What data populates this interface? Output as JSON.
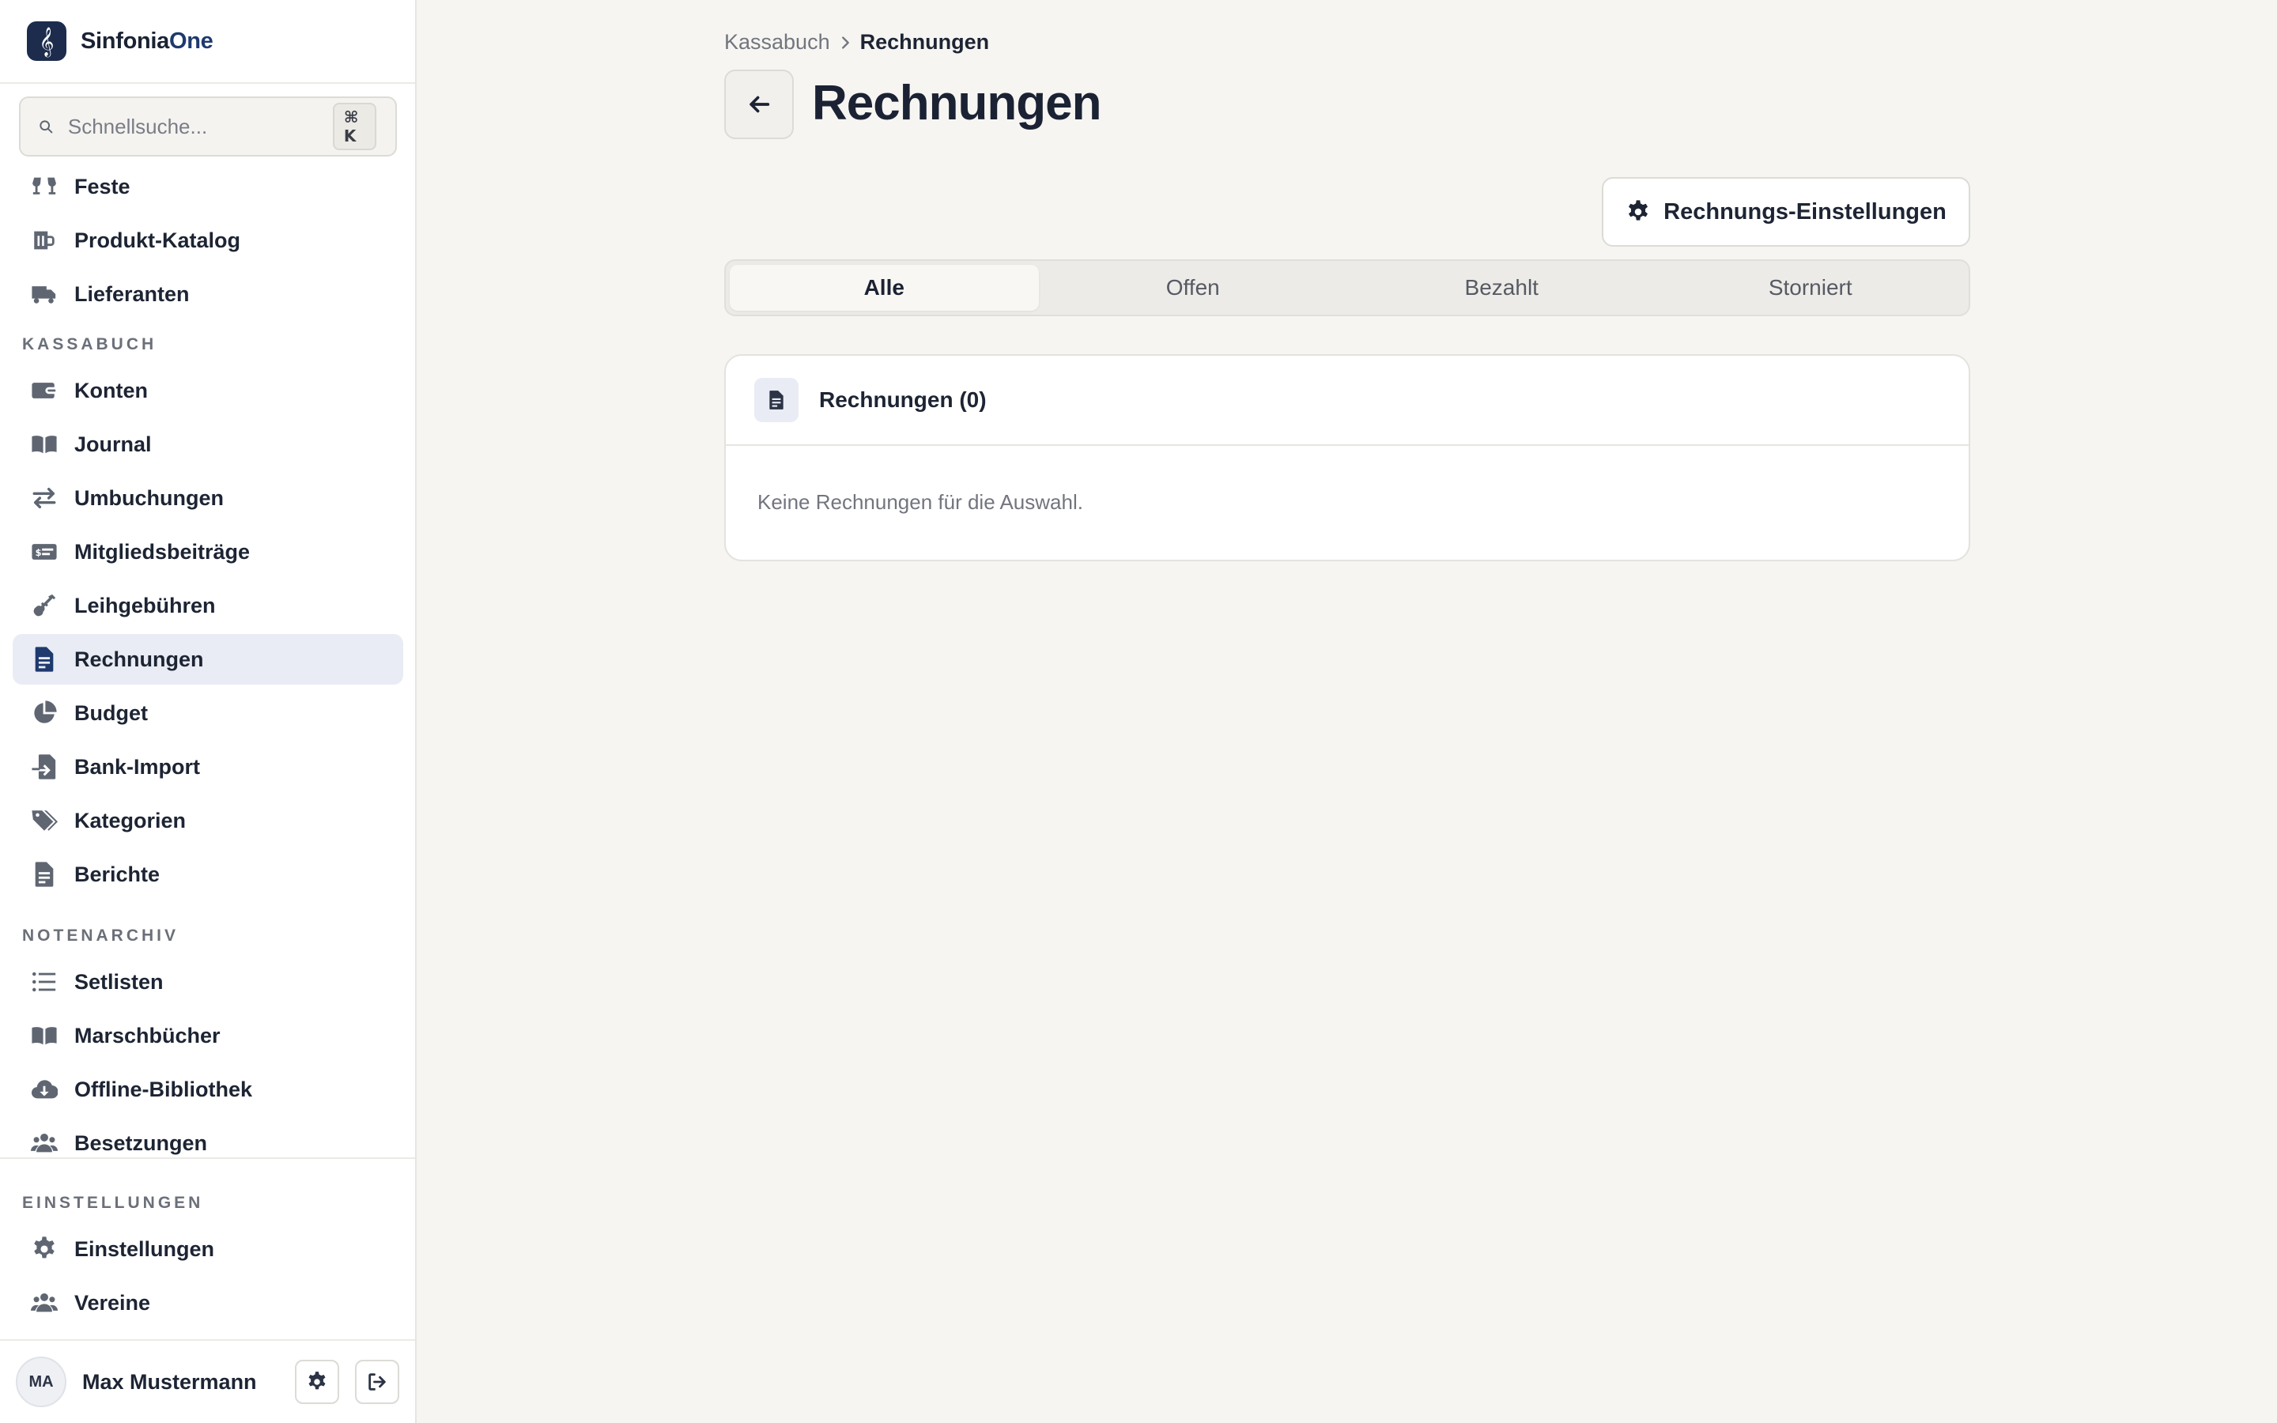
{
  "brand": {
    "prefix": "Sinfonia",
    "suffix": "One"
  },
  "search": {
    "placeholder": "Schnellsuche...",
    "shortcut": "⌘ K"
  },
  "sidebar": {
    "items_top": [
      {
        "label": "Feste",
        "icon": "glasses-cheers-icon"
      },
      {
        "label": "Produkt-Katalog",
        "icon": "beer-mug-icon"
      },
      {
        "label": "Lieferanten",
        "icon": "truck-icon"
      }
    ],
    "section_kassabuch": "KASSABUCH",
    "items_kassabuch": [
      {
        "label": "Konten",
        "icon": "wallet-icon"
      },
      {
        "label": "Journal",
        "icon": "open-book-icon"
      },
      {
        "label": "Umbuchungen",
        "icon": "arrows-left-right-icon"
      },
      {
        "label": "Mitgliedsbeiträge",
        "icon": "money-check-icon"
      },
      {
        "label": "Leihgebühren",
        "icon": "guitar-icon"
      },
      {
        "label": "Rechnungen",
        "icon": "invoice-icon",
        "active": true
      },
      {
        "label": "Budget",
        "icon": "pie-chart-icon"
      },
      {
        "label": "Bank-Import",
        "icon": "file-import-icon"
      },
      {
        "label": "Kategorien",
        "icon": "tags-icon"
      },
      {
        "label": "Berichte",
        "icon": "file-lines-icon"
      }
    ],
    "section_notenarchiv": "NOTENARCHIV",
    "items_notenarchiv": [
      {
        "label": "Setlisten",
        "icon": "list-icon"
      },
      {
        "label": "Marschbücher",
        "icon": "book-icon"
      },
      {
        "label": "Offline-Bibliothek",
        "icon": "cloud-download-icon"
      },
      {
        "label": "Besetzungen",
        "icon": "users-icon"
      }
    ],
    "section_einstellungen": "EINSTELLUNGEN",
    "items_einstellungen": [
      {
        "label": "Einstellungen",
        "icon": "gear-icon"
      },
      {
        "label": "Vereine",
        "icon": "users-icon"
      }
    ]
  },
  "user": {
    "initials": "MA",
    "name": "Max Mustermann"
  },
  "breadcrumb": {
    "parent": "Kassabuch",
    "current": "Rechnungen"
  },
  "page": {
    "title": "Rechnungen",
    "settings_button": "Rechnungs-Einstellungen"
  },
  "tabs": [
    {
      "label": "Alle",
      "active": true
    },
    {
      "label": "Offen"
    },
    {
      "label": "Bezahlt"
    },
    {
      "label": "Storniert"
    }
  ],
  "card": {
    "title": "Rechnungen (0)",
    "empty_text": "Keine Rechnungen für die Auswahl."
  },
  "colors": {
    "accent": "#1e3a6e",
    "active_bg": "#e9ecf4",
    "icon": "#5f6672",
    "background": "#f6f5f2"
  }
}
